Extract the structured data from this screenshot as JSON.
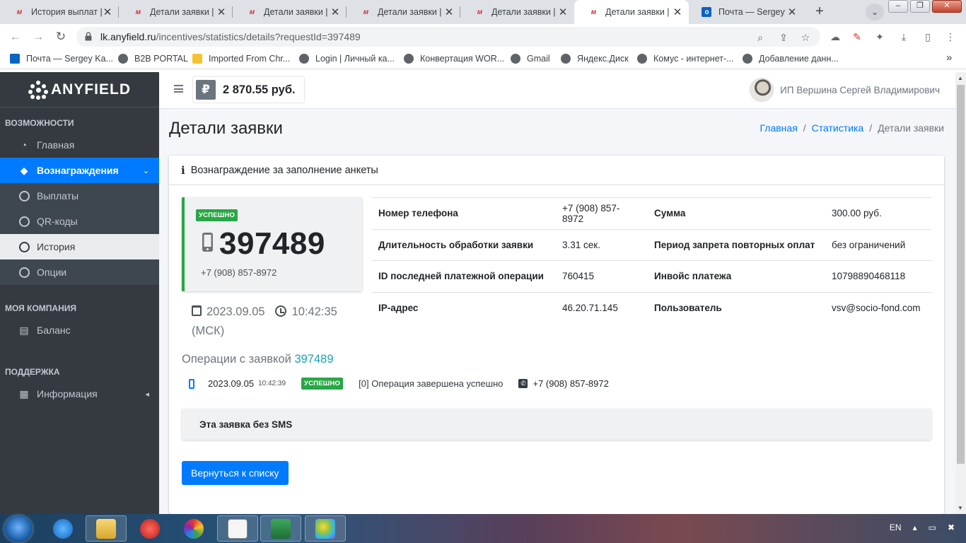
{
  "browser": {
    "tabs": [
      {
        "title": "История выплат | Л",
        "active": false
      },
      {
        "title": "Детали заявки | Л",
        "active": false
      },
      {
        "title": "Детали заявки | Л",
        "active": false
      },
      {
        "title": "Детали заявки | Л",
        "active": false
      },
      {
        "title": "Детали заявки | Л",
        "active": false
      },
      {
        "title": "Детали заявки | Л",
        "active": true
      },
      {
        "title": "Почта — Sergey K",
        "active": false
      }
    ],
    "tab_close": "✕",
    "new_tab": "+",
    "url_host": "lk.anyfield.ru",
    "url_path": "/incentives/statistics/details?requestId=397489",
    "bookmarks": [
      {
        "label": "Почта — Sergey Ka...",
        "icon": "outlook"
      },
      {
        "label": "B2B PORTAL",
        "icon": "globe"
      },
      {
        "label": "Imported From Chr...",
        "icon": "folder"
      },
      {
        "label": "Login | Личный ка...",
        "icon": "globe"
      },
      {
        "label": "Конвертация WOR...",
        "icon": "globe"
      },
      {
        "label": "Gmail",
        "icon": "globe"
      },
      {
        "label": "Яндекс.Диск",
        "icon": "globe"
      },
      {
        "label": "Комус - интернет-...",
        "icon": "globe"
      },
      {
        "label": "Добавление данн...",
        "icon": "globe"
      }
    ],
    "bookmarks_more": "»"
  },
  "brand": {
    "name": "ANYFIELD"
  },
  "sidebar": {
    "sections": [
      {
        "header": "ВОЗМОЖНОСТИ"
      },
      {
        "header": "МОЯ КОМПАНИЯ"
      },
      {
        "header": "ПОДДЕРЖКА"
      }
    ],
    "items": {
      "home": "Главная",
      "rewards": "Вознаграждения",
      "payouts": "Выплаты",
      "qr": "QR-коды",
      "history": "История",
      "options": "Опции",
      "balance": "Баланс",
      "info": "Информация"
    }
  },
  "topbar": {
    "currency_symbol": "₽",
    "balance": "2 870.55 руб.",
    "user_name": "ИП Вершина Сергей Владимирович"
  },
  "header": {
    "title": "Детали заявки",
    "breadcrumb": [
      "Главная",
      "Статистика",
      "Детали заявки"
    ],
    "breadcrumb_sep": "/"
  },
  "card": {
    "title": "Вознаграждение за заполнение анкеты",
    "status": "УСПЕШНО",
    "request_id": "397489",
    "phone": "+7 (908) 857-8972",
    "date": "2023.09.05",
    "time": "10:42:35",
    "tz": "(МСК)",
    "details": [
      {
        "l1": "Номер телефона",
        "v1": "+7 (908) 857-8972",
        "l2": "Сумма",
        "v2": "300.00 руб."
      },
      {
        "l1": "Длительность обработки заявки",
        "v1": "3.31 сек.",
        "l2": "Период запрета повторных оплат",
        "v2": "без ограничений"
      },
      {
        "l1": "ID последней платежной операции",
        "v1": "760415",
        "l2": "Инвойс платежа",
        "v2": "10798890468118"
      },
      {
        "l1": "IP-адрес",
        "v1": "46.20.71.145",
        "l2": "Пользователь",
        "v2": "vsv@socio-fond.com"
      }
    ],
    "ops_title": "Операции с заявкой",
    "ops_link": "397489",
    "op": {
      "date": "2023.09.05",
      "time": "10:42:39",
      "status": "УСПЕШНО",
      "text": "[0] Операция завершена успешно",
      "phone": "+7 (908) 857-8972"
    },
    "sms_note": "Эта заявка без SMS",
    "back_button": "Вернуться к списку"
  },
  "taskbar": {
    "lang": "EN"
  },
  "colors": {
    "primary": "#007bff",
    "success": "#28a745",
    "sidebar": "#343a40",
    "link_teal": "#17a2b8"
  }
}
